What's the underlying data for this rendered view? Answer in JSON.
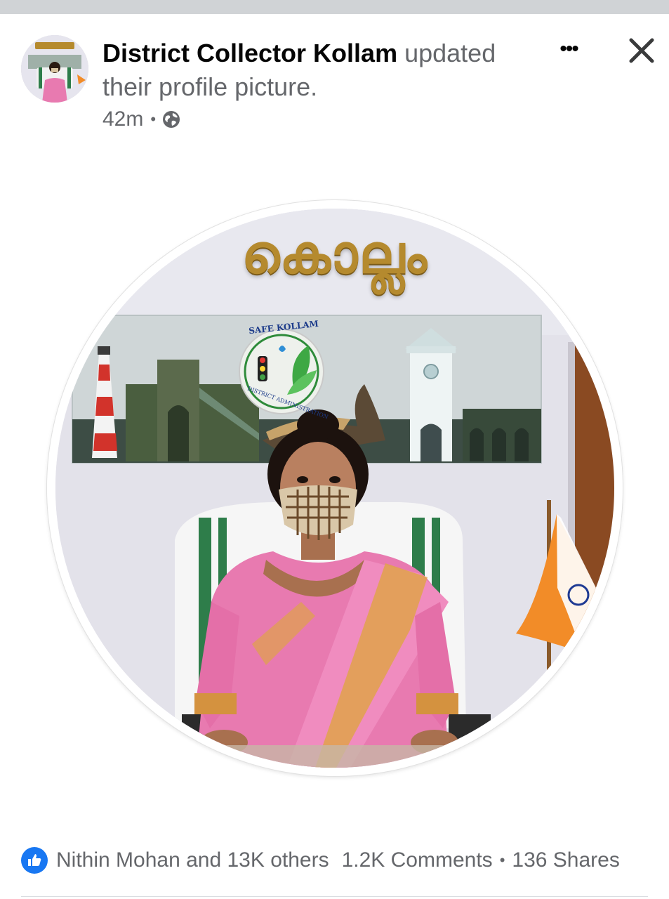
{
  "post": {
    "author": "District Collector Kollam",
    "action": " updated their profile picture.",
    "timestamp": "42m",
    "separator": "•",
    "privacy_icon": "globe-icon"
  },
  "header_actions": {
    "more_label": "•••",
    "close_icon": "close-icon"
  },
  "photo": {
    "sign_text": "കൊല്ലം",
    "logo_top_text": "SAFE KOLLAM",
    "logo_bottom_text": "DISTRICT ADMINISTRATION"
  },
  "reactions": {
    "like_icon": "thumbs-up-icon",
    "likes_text": "Nithin Mohan and 13K others",
    "comments_text": "1.2K Comments",
    "separator": "•",
    "shares_text": "136 Shares"
  },
  "colors": {
    "accent": "#1877f2",
    "secondary_text": "#65676b",
    "saree_pink": "#e87ab0",
    "saree_border": "#e0a24a"
  }
}
